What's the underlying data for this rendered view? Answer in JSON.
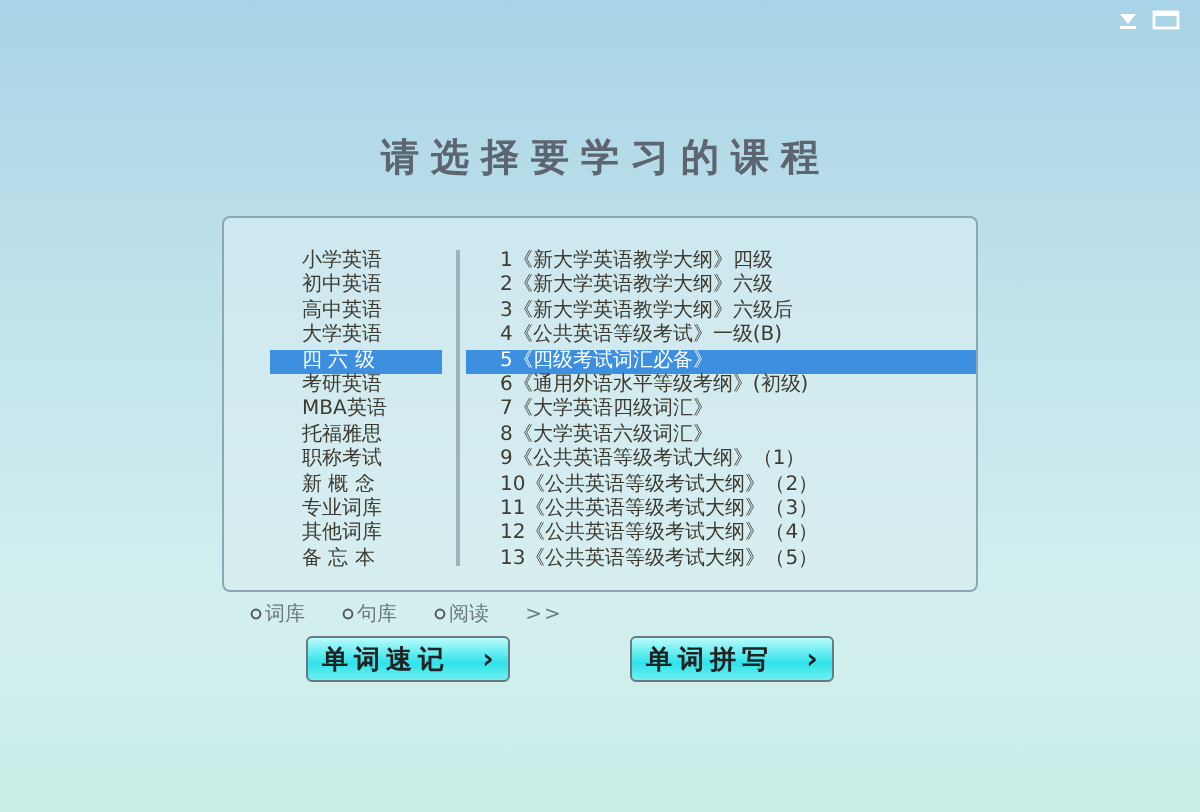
{
  "title": "请选择要学习的课程",
  "categories": [
    {
      "label": "小学英语",
      "selected": false
    },
    {
      "label": "初中英语",
      "selected": false
    },
    {
      "label": "高中英语",
      "selected": false
    },
    {
      "label": "大学英语",
      "selected": false
    },
    {
      "label": "四 六 级",
      "selected": true
    },
    {
      "label": "考研英语",
      "selected": false
    },
    {
      "label": "MBA英语",
      "selected": false
    },
    {
      "label": "托福雅思",
      "selected": false
    },
    {
      "label": "职称考试",
      "selected": false
    },
    {
      "label": "新 概 念",
      "selected": false
    },
    {
      "label": "专业词库",
      "selected": false
    },
    {
      "label": "其他词库",
      "selected": false
    },
    {
      "label": "备 忘 本",
      "selected": false
    }
  ],
  "courses": [
    {
      "label": "1《新大学英语教学大纲》四级",
      "selected": false
    },
    {
      "label": "2《新大学英语教学大纲》六级",
      "selected": false
    },
    {
      "label": "3《新大学英语教学大纲》六级后",
      "selected": false
    },
    {
      "label": "4《公共英语等级考试》一级(B)",
      "selected": false
    },
    {
      "label": "5《四级考试词汇必备》",
      "selected": true
    },
    {
      "label": "6《通用外语水平等级考纲》(初级)",
      "selected": false
    },
    {
      "label": "7《大学英语四级词汇》",
      "selected": false
    },
    {
      "label": "8《大学英语六级词汇》",
      "selected": false
    },
    {
      "label": "9《公共英语等级考试大纲》（1）",
      "selected": false
    },
    {
      "label": "10《公共英语等级考试大纲》（2）",
      "selected": false
    },
    {
      "label": "11《公共英语等级考试大纲》（3）",
      "selected": false
    },
    {
      "label": "12《公共英语等级考试大纲》（4）",
      "selected": false
    },
    {
      "label": "13《公共英语等级考试大纲》（5）",
      "selected": false
    }
  ],
  "modes": [
    {
      "label": "词库"
    },
    {
      "label": "句库"
    },
    {
      "label": "阅读"
    }
  ],
  "more": ">>",
  "buttons": [
    {
      "label": "单词速记",
      "arrow": "›"
    },
    {
      "label": "单词拼写",
      "arrow": "›"
    }
  ]
}
